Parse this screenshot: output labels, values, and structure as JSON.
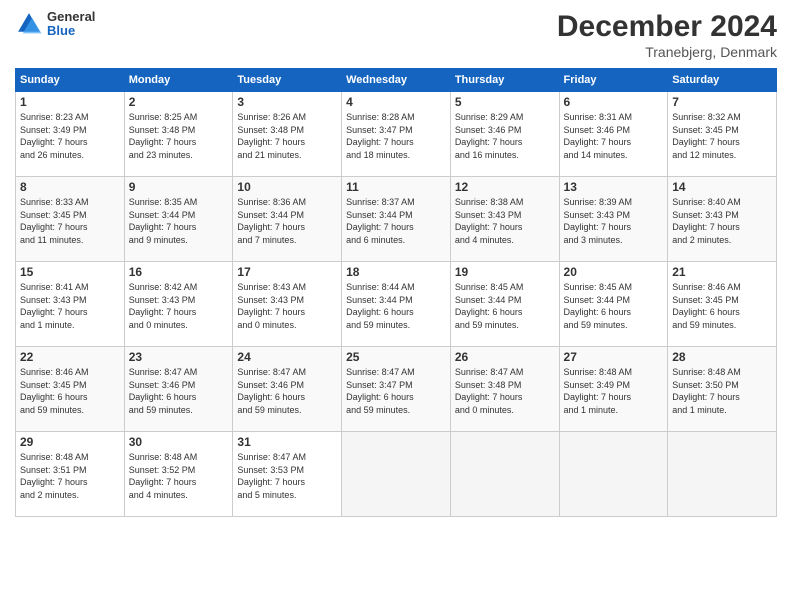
{
  "header": {
    "logo": {
      "general": "General",
      "blue": "Blue"
    },
    "title": "December 2024",
    "location": "Tranebjerg, Denmark"
  },
  "weekdays": [
    "Sunday",
    "Monday",
    "Tuesday",
    "Wednesday",
    "Thursday",
    "Friday",
    "Saturday"
  ],
  "weeks": [
    [
      {
        "day": "1",
        "sunrise": "8:23 AM",
        "sunset": "3:49 PM",
        "daylight": "7 hours and 26 minutes."
      },
      {
        "day": "2",
        "sunrise": "8:25 AM",
        "sunset": "3:48 PM",
        "daylight": "7 hours and 23 minutes."
      },
      {
        "day": "3",
        "sunrise": "8:26 AM",
        "sunset": "3:48 PM",
        "daylight": "7 hours and 21 minutes."
      },
      {
        "day": "4",
        "sunrise": "8:28 AM",
        "sunset": "3:47 PM",
        "daylight": "7 hours and 18 minutes."
      },
      {
        "day": "5",
        "sunrise": "8:29 AM",
        "sunset": "3:46 PM",
        "daylight": "7 hours and 16 minutes."
      },
      {
        "day": "6",
        "sunrise": "8:31 AM",
        "sunset": "3:46 PM",
        "daylight": "7 hours and 14 minutes."
      },
      {
        "day": "7",
        "sunrise": "8:32 AM",
        "sunset": "3:45 PM",
        "daylight": "7 hours and 12 minutes."
      }
    ],
    [
      {
        "day": "8",
        "sunrise": "8:33 AM",
        "sunset": "3:45 PM",
        "daylight": "7 hours and 11 minutes."
      },
      {
        "day": "9",
        "sunrise": "8:35 AM",
        "sunset": "3:44 PM",
        "daylight": "7 hours and 9 minutes."
      },
      {
        "day": "10",
        "sunrise": "8:36 AM",
        "sunset": "3:44 PM",
        "daylight": "7 hours and 7 minutes."
      },
      {
        "day": "11",
        "sunrise": "8:37 AM",
        "sunset": "3:44 PM",
        "daylight": "7 hours and 6 minutes."
      },
      {
        "day": "12",
        "sunrise": "8:38 AM",
        "sunset": "3:43 PM",
        "daylight": "7 hours and 4 minutes."
      },
      {
        "day": "13",
        "sunrise": "8:39 AM",
        "sunset": "3:43 PM",
        "daylight": "7 hours and 3 minutes."
      },
      {
        "day": "14",
        "sunrise": "8:40 AM",
        "sunset": "3:43 PM",
        "daylight": "7 hours and 2 minutes."
      }
    ],
    [
      {
        "day": "15",
        "sunrise": "8:41 AM",
        "sunset": "3:43 PM",
        "daylight": "7 hours and 1 minute."
      },
      {
        "day": "16",
        "sunrise": "8:42 AM",
        "sunset": "3:43 PM",
        "daylight": "7 hours and 0 minutes."
      },
      {
        "day": "17",
        "sunrise": "8:43 AM",
        "sunset": "3:43 PM",
        "daylight": "7 hours and 0 minutes."
      },
      {
        "day": "18",
        "sunrise": "8:44 AM",
        "sunset": "3:44 PM",
        "daylight": "6 hours and 59 minutes."
      },
      {
        "day": "19",
        "sunrise": "8:45 AM",
        "sunset": "3:44 PM",
        "daylight": "6 hours and 59 minutes."
      },
      {
        "day": "20",
        "sunrise": "8:45 AM",
        "sunset": "3:44 PM",
        "daylight": "6 hours and 59 minutes."
      },
      {
        "day": "21",
        "sunrise": "8:46 AM",
        "sunset": "3:45 PM",
        "daylight": "6 hours and 59 minutes."
      }
    ],
    [
      {
        "day": "22",
        "sunrise": "8:46 AM",
        "sunset": "3:45 PM",
        "daylight": "6 hours and 59 minutes."
      },
      {
        "day": "23",
        "sunrise": "8:47 AM",
        "sunset": "3:46 PM",
        "daylight": "6 hours and 59 minutes."
      },
      {
        "day": "24",
        "sunrise": "8:47 AM",
        "sunset": "3:46 PM",
        "daylight": "6 hours and 59 minutes."
      },
      {
        "day": "25",
        "sunrise": "8:47 AM",
        "sunset": "3:47 PM",
        "daylight": "6 hours and 59 minutes."
      },
      {
        "day": "26",
        "sunrise": "8:47 AM",
        "sunset": "3:48 PM",
        "daylight": "7 hours and 0 minutes."
      },
      {
        "day": "27",
        "sunrise": "8:48 AM",
        "sunset": "3:49 PM",
        "daylight": "7 hours and 1 minute."
      },
      {
        "day": "28",
        "sunrise": "8:48 AM",
        "sunset": "3:50 PM",
        "daylight": "7 hours and 1 minute."
      }
    ],
    [
      {
        "day": "29",
        "sunrise": "8:48 AM",
        "sunset": "3:51 PM",
        "daylight": "7 hours and 2 minutes."
      },
      {
        "day": "30",
        "sunrise": "8:48 AM",
        "sunset": "3:52 PM",
        "daylight": "7 hours and 4 minutes."
      },
      {
        "day": "31",
        "sunrise": "8:47 AM",
        "sunset": "3:53 PM",
        "daylight": "7 hours and 5 minutes."
      },
      null,
      null,
      null,
      null
    ]
  ],
  "labels": {
    "sunrise": "Sunrise:",
    "sunset": "Sunset:",
    "daylight": "Daylight:"
  }
}
